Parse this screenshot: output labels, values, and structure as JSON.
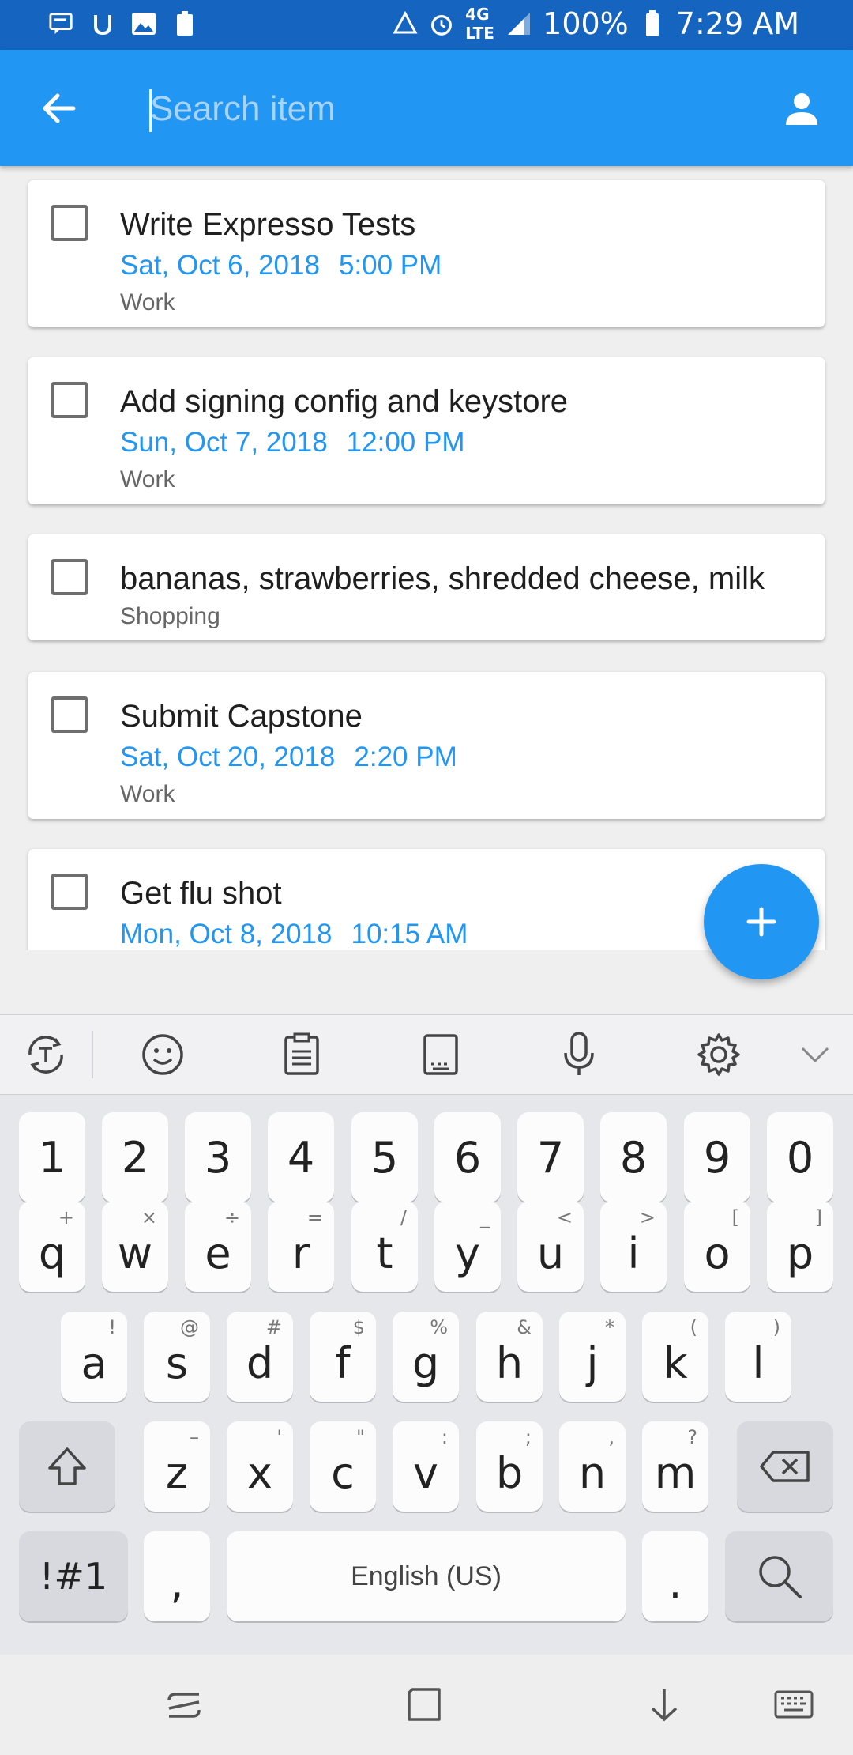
{
  "status_bar": {
    "battery_percent": "100%",
    "time": "7:29 AM",
    "network": "4G LTE",
    "icons": [
      "message-icon",
      "u-app-icon",
      "image-icon",
      "battery-saver-icon",
      "data-sync-icon",
      "alarm-icon",
      "lte-icon",
      "signal-icon",
      "battery-icon"
    ]
  },
  "app_bar": {
    "search_placeholder": "Search item",
    "search_value": "",
    "back_icon": "arrow-left-icon",
    "profile_icon": "person-icon",
    "color": "#2196f3"
  },
  "tasks": [
    {
      "title": "Write Expresso Tests",
      "date": "Sat, Oct 6, 2018",
      "time": "5:00 PM",
      "category": "Work",
      "checked": false
    },
    {
      "title": "Add signing config and keystore",
      "date": "Sun, Oct 7, 2018",
      "time": "12:00 PM",
      "category": "Work",
      "checked": false
    },
    {
      "title": "bananas, strawberries,  shredded cheese,  milk",
      "date": "",
      "time": "",
      "category": "Shopping",
      "checked": false
    },
    {
      "title": "Submit Capstone",
      "date": "Sat, Oct 20, 2018",
      "time": "2:20 PM",
      "category": "Work",
      "checked": false
    },
    {
      "title": "Get flu shot",
      "date": "Mon, Oct 8, 2018",
      "time": "10:15 AM",
      "category": "",
      "checked": false
    }
  ],
  "fab": {
    "icon": "plus-icon",
    "color": "#2196f3"
  },
  "keyboard": {
    "toolbar": [
      "text-mode-icon",
      "emoji-icon",
      "clipboard-icon",
      "keyboard-size-icon",
      "microphone-icon",
      "settings-icon",
      "chevron-down-icon"
    ],
    "number_row": [
      "1",
      "2",
      "3",
      "4",
      "5",
      "6",
      "7",
      "8",
      "9",
      "0"
    ],
    "row1": [
      {
        "k": "q",
        "s": "+"
      },
      {
        "k": "w",
        "s": "×"
      },
      {
        "k": "e",
        "s": "÷"
      },
      {
        "k": "r",
        "s": "="
      },
      {
        "k": "t",
        "s": "/"
      },
      {
        "k": "y",
        "s": "_"
      },
      {
        "k": "u",
        "s": "<"
      },
      {
        "k": "i",
        "s": ">"
      },
      {
        "k": "o",
        "s": "["
      },
      {
        "k": "p",
        "s": "]"
      }
    ],
    "row2": [
      {
        "k": "a",
        "s": "!"
      },
      {
        "k": "s",
        "s": "@"
      },
      {
        "k": "d",
        "s": "#"
      },
      {
        "k": "f",
        "s": "$"
      },
      {
        "k": "g",
        "s": "%"
      },
      {
        "k": "h",
        "s": "&"
      },
      {
        "k": "j",
        "s": "*"
      },
      {
        "k": "k",
        "s": "("
      },
      {
        "k": "l",
        "s": ")"
      }
    ],
    "row3": [
      {
        "k": "z",
        "s": "–"
      },
      {
        "k": "x",
        "s": "'"
      },
      {
        "k": "c",
        "s": "\""
      },
      {
        "k": "v",
        "s": ":"
      },
      {
        "k": "b",
        "s": ";"
      },
      {
        "k": "n",
        "s": ","
      },
      {
        "k": "m",
        "s": "?"
      }
    ],
    "symbols_label": "!#1",
    "comma_label": ",",
    "space_label": "English (US)",
    "period_label": ".",
    "shift_icon": "shift-icon",
    "backspace_icon": "backspace-icon",
    "search_icon": "search-icon"
  },
  "nav_bar": {
    "icons": [
      "recents-icon",
      "home-icon",
      "back-icon",
      "keyboard-icon"
    ]
  }
}
